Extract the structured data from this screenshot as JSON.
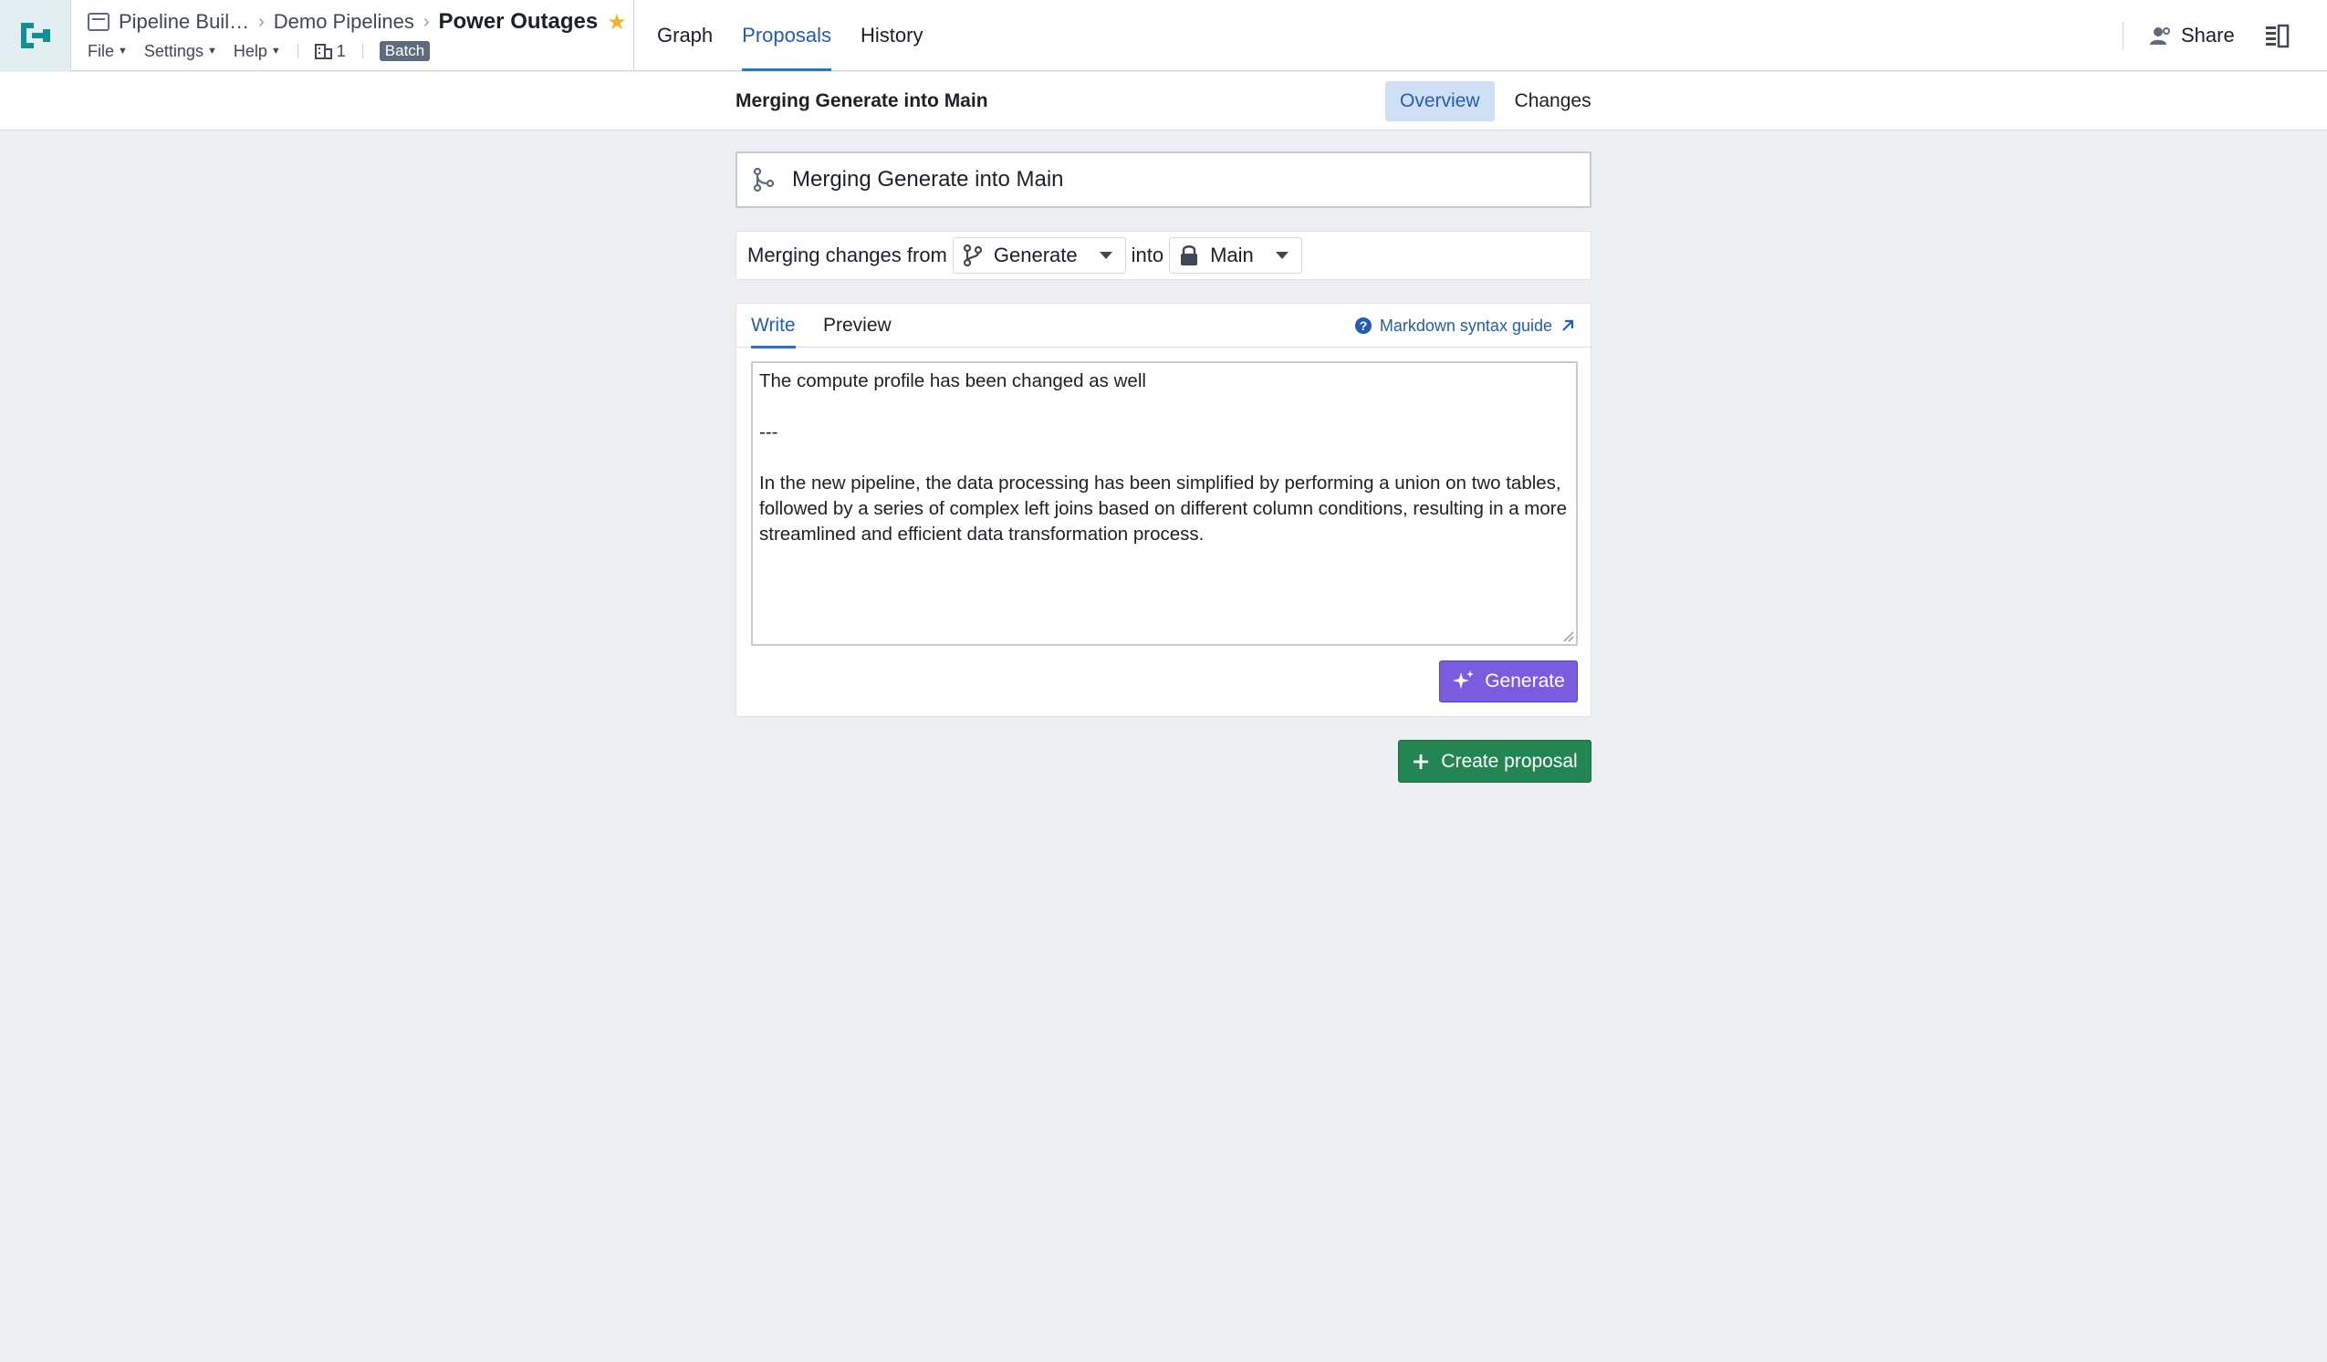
{
  "breadcrumb": {
    "items": [
      "Pipeline Buil…",
      "Demo Pipelines"
    ],
    "title": "Power Outages"
  },
  "menus": {
    "file": "File",
    "settings": "Settings",
    "help": "Help",
    "count": "1",
    "badge": "Batch"
  },
  "topnav": {
    "tabs": [
      {
        "label": "Graph",
        "active": false
      },
      {
        "label": "Proposals",
        "active": true
      },
      {
        "label": "History",
        "active": false
      }
    ],
    "share": "Share"
  },
  "subheader": {
    "title": "Merging Generate into Main",
    "tabs": [
      {
        "label": "Overview",
        "active": true
      },
      {
        "label": "Changes",
        "active": false
      }
    ]
  },
  "proposal": {
    "title_value": "Merging Generate into Main",
    "merge_prefix": "Merging changes from",
    "source_branch": "Generate",
    "into_label": "into",
    "target_branch": "Main"
  },
  "editor": {
    "tabs": [
      {
        "label": "Write",
        "active": true
      },
      {
        "label": "Preview",
        "active": false
      }
    ],
    "md_guide": "Markdown syntax guide",
    "body": "The compute profile has been changed as well\n\n---\n\nIn the new pipeline, the data processing has been simplified by performing a union on two tables, followed by a series of complex left joins based on different column conditions, resulting in a more streamlined and efficient data transformation process.",
    "generate_label": "Generate"
  },
  "actions": {
    "create_label": "Create proposal"
  },
  "colors": {
    "accent": "#2d72d2",
    "generate": "#7a5ce0",
    "create": "#238551",
    "logo": "#0f9193"
  }
}
